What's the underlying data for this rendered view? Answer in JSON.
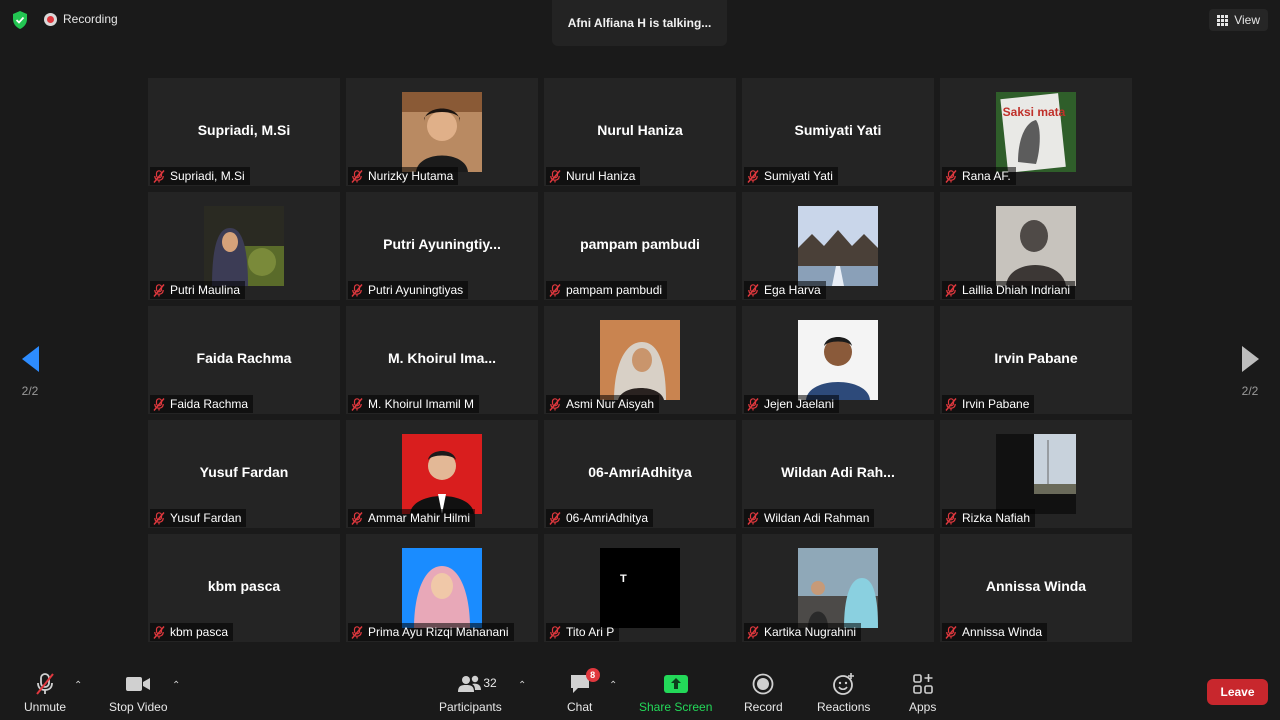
{
  "top": {
    "recording_label": "Recording",
    "talking_text": "Afni Alfiana H is talking...",
    "view_label": "View"
  },
  "pagination": {
    "left_page": "2/2",
    "right_page": "2/2"
  },
  "participants": [
    {
      "display": "Supriadi, M.Si",
      "label": "Supriadi, M.Si",
      "photo": false
    },
    {
      "display": "",
      "label": "Nurizky Hutama",
      "photo": "person-young-man"
    },
    {
      "display": "Nurul Haniza",
      "label": "Nurul Haniza",
      "photo": false
    },
    {
      "display": "Sumiyati Yati",
      "label": "Sumiyati Yati",
      "photo": false
    },
    {
      "display": "",
      "label": "Rana AF.",
      "photo": "book-cover-saksi-mata",
      "photo_text": "Saksi mata"
    },
    {
      "display": "",
      "label": "Putri Maulina",
      "photo": "woman-hijab-outdoor"
    },
    {
      "display": "Putri Ayuningtiy...",
      "label": "Putri Ayuningtiyas",
      "photo": false
    },
    {
      "display": "pampam pambudi",
      "label": "pampam pambudi",
      "photo": false
    },
    {
      "display": "",
      "label": "Ega Harva",
      "photo": "building-sky"
    },
    {
      "display": "",
      "label": "Laillia Dhiah Indriani",
      "photo": "blurred-person"
    },
    {
      "display": "Faida Rachma",
      "label": "Faida Rachma",
      "photo": false
    },
    {
      "display": "M. Khoirul Ima...",
      "label": "M. Khoirul Imamil M",
      "photo": false
    },
    {
      "display": "",
      "label": "Asmi Nur Aisyah",
      "photo": "woman-hijab-orange"
    },
    {
      "display": "",
      "label": "Jejen Jaelani",
      "photo": "man-portrait-white"
    },
    {
      "display": "Irvin Pabane",
      "label": "Irvin Pabane",
      "photo": false
    },
    {
      "display": "Yusuf Fardan",
      "label": "Yusuf Fardan",
      "photo": false
    },
    {
      "display": "",
      "label": "Ammar Mahir Hilmi",
      "photo": "man-portrait-red"
    },
    {
      "display": "06-AmriAdhitya",
      "label": "06-AmriAdhitya",
      "photo": false
    },
    {
      "display": "Wildan Adi Rah...",
      "label": "Wildan Adi Rahman",
      "photo": false
    },
    {
      "display": "",
      "label": "Rizka Nafiah",
      "photo": "window-view"
    },
    {
      "display": "kbm pasca",
      "label": "kbm pasca",
      "photo": false
    },
    {
      "display": "",
      "label": "Prima Ayu Rizqi Mahanani",
      "photo": "woman-hijab-blue"
    },
    {
      "display": "",
      "label": "Tito Ari P",
      "photo": "black-square-letter",
      "photo_text": "T"
    },
    {
      "display": "",
      "label": "Kartika Nugrahini",
      "photo": "family-outdoor"
    },
    {
      "display": "Annissa Winda",
      "label": "Annissa Winda",
      "photo": false
    }
  ],
  "toolbar": {
    "unmute": "Unmute",
    "stop_video": "Stop Video",
    "participants": "Participants",
    "participants_count": "32",
    "chat": "Chat",
    "chat_badge": "8",
    "share_screen": "Share Screen",
    "record": "Record",
    "reactions": "Reactions",
    "apps": "Apps",
    "leave": "Leave"
  },
  "colors": {
    "background": "#1a1a1a",
    "tile": "#242424",
    "accent_blue": "#2d8cff",
    "share_green": "#23d959",
    "leave_red": "#c8272d",
    "muted_red": "#e0383e"
  }
}
